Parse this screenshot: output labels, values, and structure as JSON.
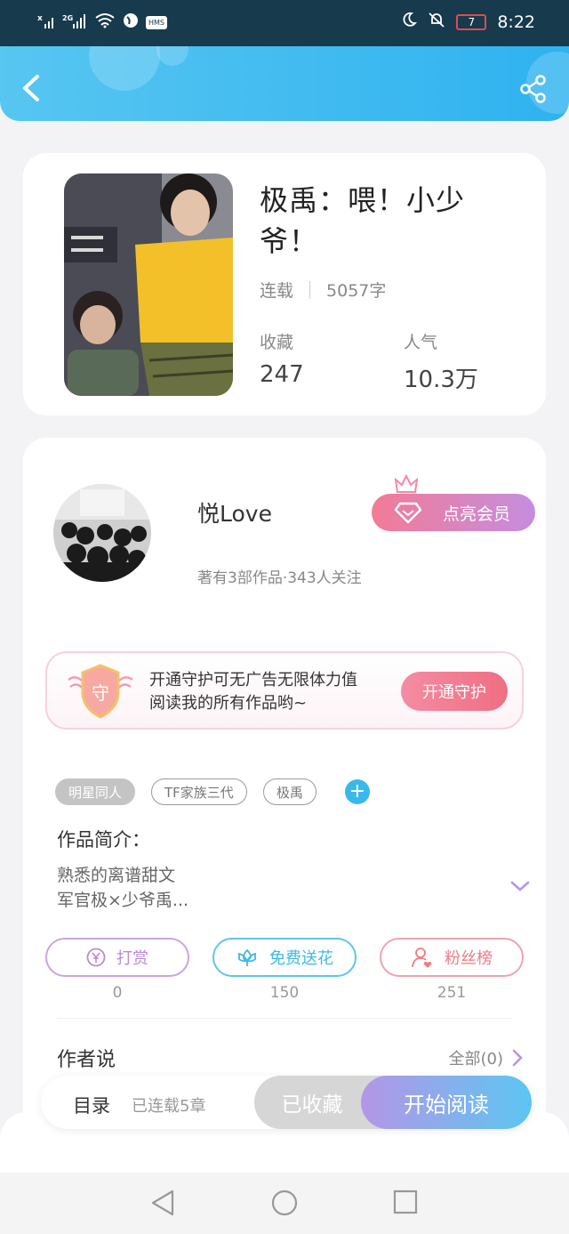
{
  "status_bar": {
    "time": "8:22",
    "network": "2G",
    "battery": "7",
    "hms": "HMS"
  },
  "book": {
    "title": "极禹：喂！小少爷！",
    "status": "连载",
    "word_count": "5057字",
    "favorites_label": "收藏",
    "favorites_value": "247",
    "popularity_label": "人气",
    "popularity_value": "10.3万"
  },
  "author": {
    "name": "悦Love",
    "summary": "著有3部作品·343人关注",
    "vip_label": "点亮会员"
  },
  "guard": {
    "badge_char": "守",
    "line1": "开通守护可无广告无限体力值",
    "line2": "阅读我的所有作品哟~",
    "button": "开通守护"
  },
  "tags": [
    "明星同人",
    "TF家族三代",
    "极禹"
  ],
  "intro": {
    "label": "作品简介：",
    "line1": "熟悉的离谱甜文",
    "line2": "军官极×少爷禹..."
  },
  "actions": [
    {
      "label": "打赏",
      "count": "0",
      "color": "#b88ad9",
      "icon": "yen-icon"
    },
    {
      "label": "免费送花",
      "count": "150",
      "color": "#3fb8e8",
      "icon": "flower-icon"
    },
    {
      "label": "粉丝榜",
      "count": "251",
      "color": "#ec7d86",
      "icon": "fan-icon"
    }
  ],
  "author_say": {
    "label": "作者说",
    "all": "全部(0)"
  },
  "bottom": {
    "toc": "目录",
    "toc_sub": "已连载5章",
    "favorited": "已收藏",
    "read": "开始阅读"
  }
}
